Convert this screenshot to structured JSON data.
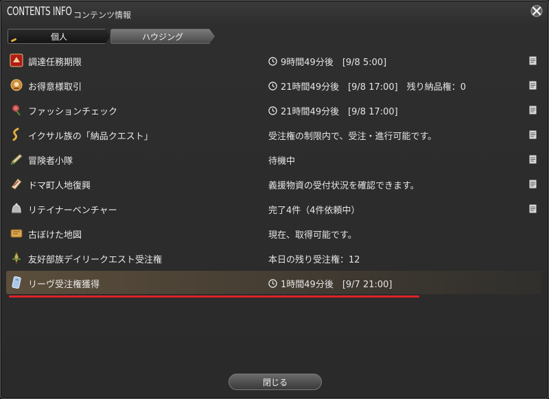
{
  "window": {
    "title_en": "CONTENTS INFO",
    "title_jp": "コンテンツ情報",
    "close_label": "閉じる"
  },
  "tabs": [
    {
      "label": "個人",
      "active": true
    },
    {
      "label": "ハウジング",
      "active": false
    }
  ],
  "rows": [
    {
      "name": "調達任務期限",
      "icon": "grand-company-icon",
      "has_clock": true,
      "status": "9時間49分後　[9/8 5:00]",
      "detail": true
    },
    {
      "name": "お得意様取引",
      "icon": "custom-delivery-icon",
      "has_clock": true,
      "status": "21時間49分後　[9/8 17:00]　残り納品権：0",
      "detail": true
    },
    {
      "name": "ファッションチェック",
      "icon": "rose-icon",
      "has_clock": true,
      "status": "21時間49分後　[9/8 17:00]",
      "detail": true
    },
    {
      "name": "イクサル族の「納品クエスト」",
      "icon": "ixal-icon",
      "has_clock": false,
      "status": "受注権の制限内で、受注・進行可能です。",
      "detail": true
    },
    {
      "name": "冒険者小隊",
      "icon": "squadron-icon",
      "has_clock": false,
      "status": "待機中",
      "detail": true
    },
    {
      "name": "ドマ町人地復興",
      "icon": "doman-enclave-icon",
      "has_clock": false,
      "status": "義援物資の受付状況を確認できます。",
      "detail": true
    },
    {
      "name": "リテイナーベンチャー",
      "icon": "retainer-bell-icon",
      "has_clock": false,
      "status": "完了4件（4件依頼中）",
      "detail": true
    },
    {
      "name": "古ぼけた地図",
      "icon": "treasure-map-icon",
      "has_clock": false,
      "status": "現在、取得可能です。",
      "detail": false
    },
    {
      "name": "友好部族デイリークエスト受注権",
      "icon": "beast-tribe-icon",
      "has_clock": false,
      "status": "本日の残り受注権：12",
      "detail": false
    },
    {
      "name": "リーヴ受注権獲得",
      "icon": "levequest-icon",
      "has_clock": true,
      "status": "1時間49分後　[9/7 21:00]",
      "detail": false,
      "selected": true
    }
  ],
  "colors": {
    "accent_underline": "#e0232a",
    "tab_active_marker": "#e2b436"
  }
}
